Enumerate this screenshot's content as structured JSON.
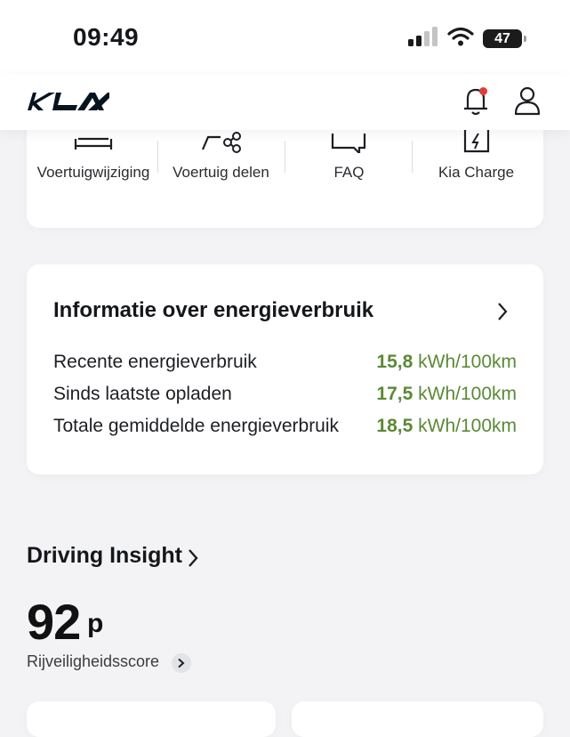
{
  "status_bar": {
    "time": "09:49",
    "battery": "47"
  },
  "header": {
    "logo_alt": "KIA"
  },
  "quick_actions": [
    {
      "label": "Voertuigwijziging",
      "icon": "car-swap-icon"
    },
    {
      "label": "Voertuig delen",
      "icon": "car-share-icon"
    },
    {
      "label": "FAQ",
      "icon": "faq-chat-icon"
    },
    {
      "label": "Kia Charge",
      "icon": "charge-card-icon"
    }
  ],
  "energy": {
    "title": "Informatie over energieverbruik",
    "rows": [
      {
        "label": "Recente energieverbruik",
        "value": "15,8",
        "unit": "kWh/100km"
      },
      {
        "label": "Sinds laatste opladen",
        "value": "17,5",
        "unit": "kWh/100km"
      },
      {
        "label": "Totale gemiddelde energieverbruik",
        "value": "18,5",
        "unit": "kWh/100km"
      }
    ]
  },
  "driving_insight": {
    "title": "Driving Insight",
    "score": "92",
    "score_unit": "p",
    "score_label": "Rijveiligheidsscore"
  },
  "colors": {
    "accent_green": "#5a8a35",
    "notification_dot": "#e53935"
  }
}
